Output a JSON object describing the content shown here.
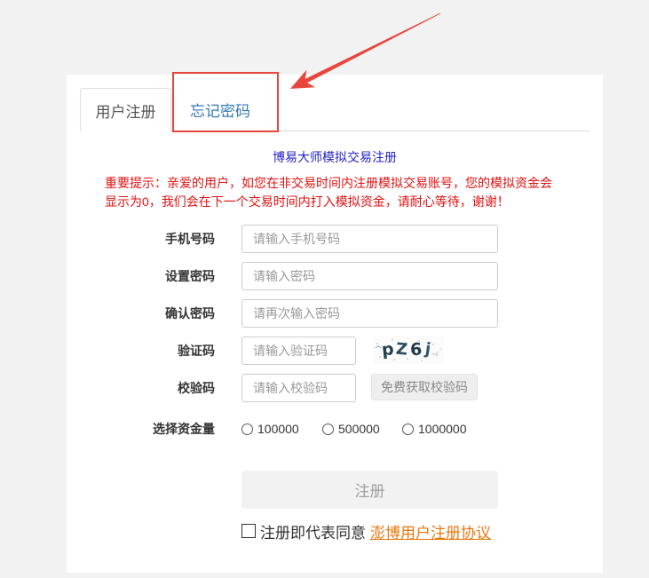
{
  "tabs": [
    {
      "label": "用户注册",
      "active": true
    },
    {
      "label": "忘记密码",
      "active": false
    }
  ],
  "form": {
    "title": "博易大师模拟交易注册",
    "notice": [
      "重要提示：亲爱的用户，如您在非交易时间内注册模拟交易账号，您的模拟资金会",
      "显示为0，我们会在下一个交易时间内打入模拟资金，请耐心等待，谢谢！"
    ],
    "phone": {
      "label": "手机号码",
      "placeholder": "请输入手机号码"
    },
    "password": {
      "label": "设置密码",
      "placeholder": "请输入密码"
    },
    "confirm_password": {
      "label": "确认密码",
      "placeholder": "请再次输入密码"
    },
    "captcha": {
      "label": "验证码",
      "placeholder": "请输入验证码",
      "image_chars": [
        "p",
        "Z",
        "6",
        "j"
      ]
    },
    "sms_code": {
      "label": "校验码",
      "placeholder": "请输入校验码",
      "button_label": "免费获取校验码"
    },
    "fund_amount": {
      "label": "选择资金量",
      "options": [
        "100000",
        "500000",
        "1000000"
      ]
    },
    "submit_label": "注册",
    "agreement": {
      "checked": false,
      "text": "注册即代表同意",
      "link_text": "澎博用户注册协议"
    }
  },
  "colors": {
    "page_bg": "#f2f2f2",
    "title_blue": "#2323c8",
    "notice_red": "#e01010",
    "tab_link_blue": "#337ab7",
    "agreement_link_orange": "#e8780f",
    "annotation_red": "#e8453c"
  }
}
